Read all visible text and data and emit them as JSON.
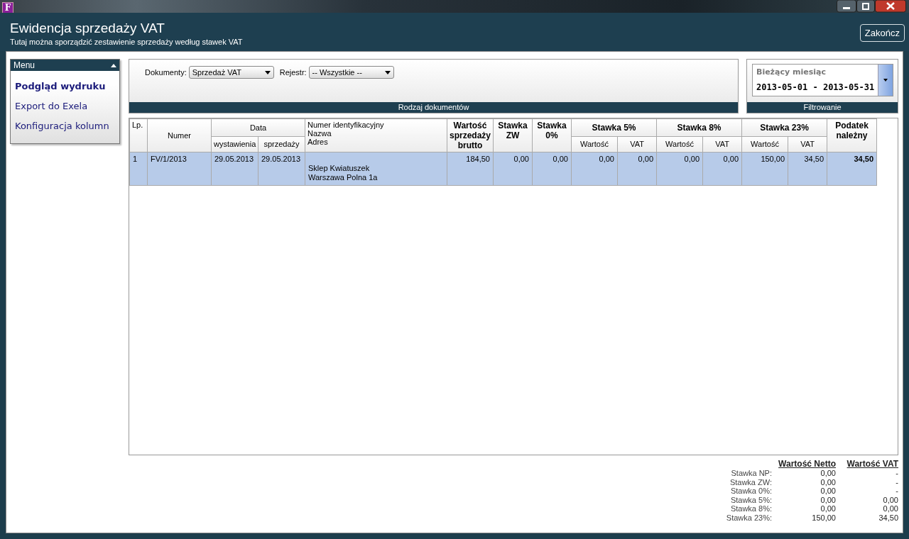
{
  "window": {
    "app_icon": "F"
  },
  "header": {
    "title": "Ewidencja sprzedaży VAT",
    "subtitle": "Tutaj można sporządzić zestawienie sprzedaży według stawek VAT",
    "close_button": "Zakończ"
  },
  "menu": {
    "title": "Menu",
    "expanded": true,
    "items": [
      {
        "label": "Podgląd wydruku",
        "selected": true
      },
      {
        "label": "Export do Exela",
        "selected": false
      },
      {
        "label": "Konfiguracja kolumn",
        "selected": false
      }
    ]
  },
  "documents": {
    "filters": [
      {
        "label": "Dokumenty:",
        "value": "Sprzedaż VAT"
      },
      {
        "label": "Rejestr:",
        "value": "-- Wszystkie --"
      }
    ],
    "footer": "Rodzaj dokumentów"
  },
  "filter": {
    "label": "Bieżący miesiąc",
    "value": "2013-05-01 - 2013-05-31",
    "footer": "Filtrowanie"
  },
  "table": {
    "columns": [
      {
        "label": "Lp.",
        "kind": "plain"
      },
      {
        "label": "Numer",
        "kind": "plain"
      },
      {
        "label": "Data",
        "kind": "plain",
        "colspan": 2,
        "subcolumns": [
          {
            "label": "wystawienia",
            "kind": "plain"
          },
          {
            "label": "sprzedaży",
            "kind": "plain"
          }
        ]
      },
      {
        "lines": [
          "Numer identyfikacyjny",
          "Nazwa",
          "Adres"
        ],
        "kind": "contractor"
      },
      {
        "label": "Wartość sprzedaży brutto",
        "kind": "amount"
      },
      {
        "label": "Stawka ZW",
        "kind": "amount"
      },
      {
        "label": "Stawka 0%",
        "kind": "amount"
      },
      {
        "label": "Stawka 5%",
        "kind": "amount",
        "colspan": 2,
        "subcolumns": [
          {
            "label": "Wartość",
            "kind": "amount"
          },
          {
            "label": "VAT",
            "kind": "amount"
          }
        ]
      },
      {
        "label": "Stawka 8%",
        "kind": "amount",
        "colspan": 2,
        "subcolumns": [
          {
            "label": "Wartość",
            "kind": "amount"
          },
          {
            "label": "VAT",
            "kind": "amount"
          }
        ]
      },
      {
        "label": "Stawka 23%",
        "kind": "amount",
        "colspan": 2,
        "subcolumns": [
          {
            "label": "Wartość",
            "kind": "amount"
          },
          {
            "label": "VAT",
            "kind": "amount"
          }
        ]
      },
      {
        "label": "Podatek należny",
        "kind": "total"
      }
    ],
    "rows": [
      {
        "selected": true,
        "cells": [
          "1",
          "FV/1/2013",
          "29.05.2013",
          "29.05.2013",
          "\nSklep Kwiatuszek\nWarszawa Polna 1a",
          "184,50",
          "0,00",
          "0,00",
          "0,00",
          "0,00",
          "0,00",
          "0,00",
          "150,00",
          "34,50",
          "34,50"
        ]
      }
    ]
  },
  "summary": {
    "headers": [
      "Wartość Netto",
      "Wartość VAT"
    ],
    "rows": [
      {
        "label": "Stawka NP:",
        "netto": "0,00",
        "vat": "-"
      },
      {
        "label": "Stawka ZW:",
        "netto": "0,00",
        "vat": "-"
      },
      {
        "label": "Stawka 0%:",
        "netto": "0,00",
        "vat": "-"
      },
      {
        "label": "Stawka 5%:",
        "netto": "0,00",
        "vat": "0,00"
      },
      {
        "label": "Stawka 8%:",
        "netto": "0,00",
        "vat": "0,00"
      },
      {
        "label": "Stawka 23%:",
        "netto": "150,00",
        "vat": "34,50"
      }
    ]
  }
}
